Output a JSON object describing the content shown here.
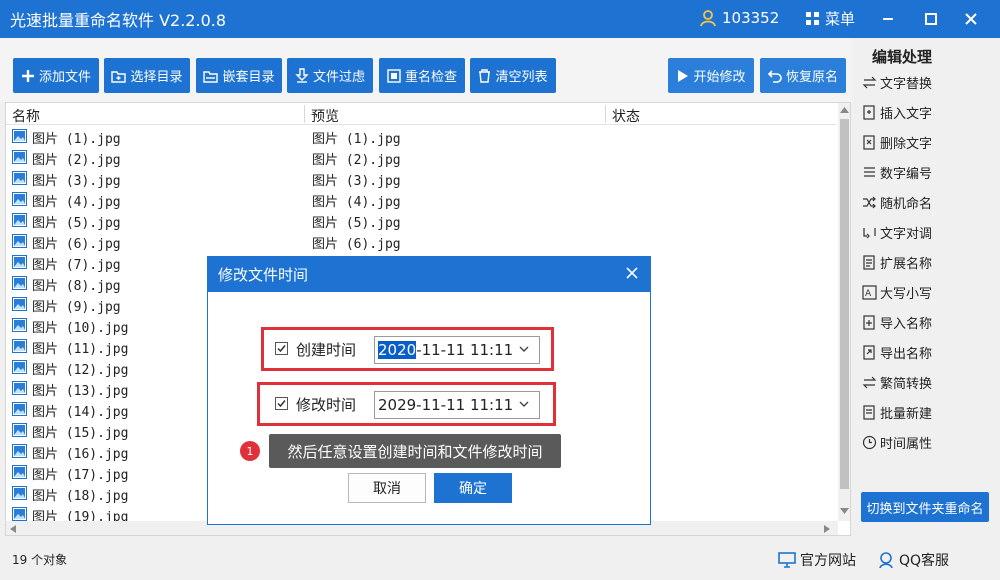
{
  "window": {
    "title": "光速批量重命名软件 V2.2.0.8",
    "user_id": "103352",
    "menu_label": "菜单"
  },
  "toolbar": {
    "add_file": "添加文件",
    "select_dir": "选择目录",
    "nested_dir": "嵌套目录",
    "file_filter": "文件过虑",
    "dup_check": "重名检查",
    "clear_list": "清空列表",
    "start_modify": "开始修改",
    "restore_name": "恢复原名"
  },
  "list": {
    "columns": [
      "名称",
      "预览",
      "状态"
    ],
    "names": [
      "图片 (1).jpg",
      "图片 (2).jpg",
      "图片 (3).jpg",
      "图片 (4).jpg",
      "图片 (5).jpg",
      "图片 (6).jpg",
      "图片 (7).jpg",
      "图片 (8).jpg",
      "图片 (9).jpg",
      "图片 (10).jpg",
      "图片 (11).jpg",
      "图片 (12).jpg",
      "图片 (13).jpg",
      "图片 (14).jpg",
      "图片 (15).jpg",
      "图片 (16).jpg",
      "图片 (17).jpg",
      "图片 (18).jpg",
      "图片 (19).jpg"
    ],
    "previews": [
      "图片 (1).jpg",
      "图片 (2).jpg",
      "图片 (3).jpg",
      "图片 (4).jpg",
      "图片 (5).jpg",
      "图片 (6).jpg"
    ]
  },
  "sidebar": {
    "title": "编辑处理",
    "items": [
      {
        "label": "文字替换",
        "icon": "swap-icon"
      },
      {
        "label": "插入文字",
        "icon": "insert-icon"
      },
      {
        "label": "删除文字",
        "icon": "delete-text-icon"
      },
      {
        "label": "数字编号",
        "icon": "numbering-icon"
      },
      {
        "label": "随机命名",
        "icon": "shuffle-icon"
      },
      {
        "label": "文字对调",
        "icon": "exchange-icon"
      },
      {
        "label": "扩展名称",
        "icon": "extension-icon"
      },
      {
        "label": "大写小写",
        "icon": "case-icon"
      },
      {
        "label": "导入名称",
        "icon": "import-icon"
      },
      {
        "label": "导出名称",
        "icon": "export-icon"
      },
      {
        "label": "繁简转换",
        "icon": "convert-icon"
      },
      {
        "label": "批量新建",
        "icon": "new-file-icon"
      },
      {
        "label": "时间属性",
        "icon": "clock-icon"
      }
    ],
    "switch_label": "切换到文件夹重命名"
  },
  "dialog": {
    "title": "修改文件时间",
    "create_label": "创建时间",
    "create_year": "2020",
    "create_rest": "-11-11 11:11",
    "modify_label": "修改时间",
    "modify_value": "2029-11-11 11:11",
    "tip_number": "1",
    "tip_text": "然后任意设置创建时间和文件修改时间",
    "cancel": "取消",
    "ok": "确定"
  },
  "status": {
    "count": "19 个对象",
    "website": "官方网站",
    "qq": "QQ客服"
  },
  "colors": {
    "accent": "#1e73d2",
    "highlight": "#e0313a"
  }
}
